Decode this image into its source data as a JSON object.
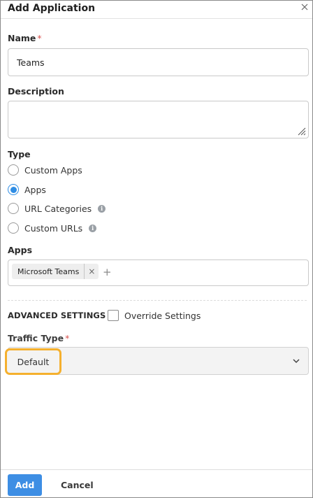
{
  "dialog": {
    "title": "Add Application"
  },
  "form": {
    "name": {
      "label": "Name",
      "required_mark": "*",
      "value": "Teams"
    },
    "description": {
      "label": "Description",
      "value": ""
    },
    "type": {
      "label": "Type",
      "options": [
        {
          "label": "Custom Apps",
          "checked": false,
          "info": false
        },
        {
          "label": "Apps",
          "checked": true,
          "info": true
        },
        {
          "label": "URL Categories",
          "checked": false,
          "info": true
        },
        {
          "label": "Custom URLs",
          "checked": false,
          "info": true
        }
      ]
    },
    "apps": {
      "label": "Apps",
      "chips": [
        "Microsoft Teams"
      ]
    },
    "advanced": {
      "label": "ADVANCED SETTINGS",
      "override_label": "Override Settings",
      "override_checked": false
    },
    "traffic_type": {
      "label": "Traffic Type",
      "required_mark": "*",
      "value": "Default"
    }
  },
  "footer": {
    "add_label": "Add",
    "cancel_label": "Cancel"
  },
  "icons": {
    "close": "close-icon",
    "info": "info-icon",
    "chevron": "chevron-down-icon",
    "remove": "remove-chip-icon",
    "add": "plus-icon"
  },
  "colors": {
    "accent": "#3d8ee4",
    "radio_selected": "#2f8de4",
    "required": "#d9534f",
    "highlight": "#f5b02e"
  }
}
